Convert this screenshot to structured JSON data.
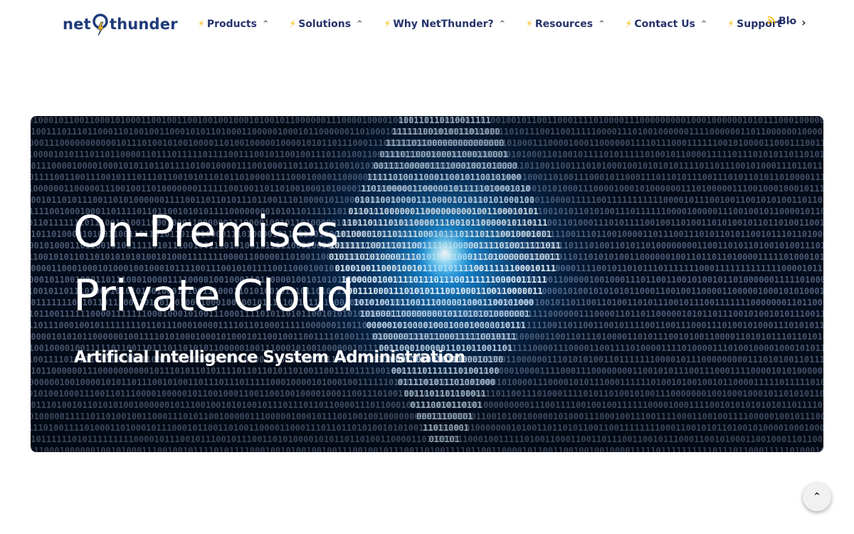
{
  "brand": {
    "prefix": "net",
    "suffix": "thunder"
  },
  "nav": {
    "items": [
      {
        "label": "Products",
        "icon": "bolt-icon"
      },
      {
        "label": "Solutions",
        "icon": "bolt-icon"
      },
      {
        "label": "Why NetThunder?",
        "icon": "bolt-icon"
      },
      {
        "label": "Resources",
        "icon": "bolt-icon"
      },
      {
        "label": "Contact Us",
        "icon": "bolt-icon"
      },
      {
        "label": "Support",
        "icon": "bolt-icon"
      },
      {
        "label": "Blog",
        "icon": "rss-icon"
      }
    ],
    "bolt_glyph": "⚡",
    "chevron_glyph": "^",
    "next_glyph": "›"
  },
  "hero": {
    "title_line1": "On-Premises",
    "title_line2": "Private Cloud",
    "subtitle": "Artificial Intelligence System Administration"
  },
  "scroll_top": {
    "glyph": "⌃"
  },
  "colors": {
    "brand_navy": "#25336b",
    "accent_yellow": "#f5b800",
    "hero_bg": "#020c1c",
    "hero_glow": "#1aa6ff"
  }
}
